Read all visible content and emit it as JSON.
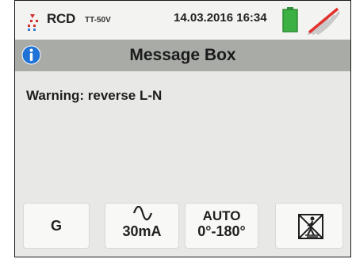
{
  "status_bar": {
    "mode": "RCD",
    "mode_sub": "TT-50V",
    "datetime": "14.03.2016  16:34",
    "icons": [
      "rcd-icon",
      "battery-icon",
      "no-signal-icon"
    ],
    "battery_color": "#3cb043",
    "signal_strike_color": "#e2312f"
  },
  "title_bar": {
    "title": "Message Box",
    "icon": "info-icon",
    "info_color": "#1f73d6"
  },
  "message": "Warning: reverse L-N",
  "softkeys": [
    {
      "label": "G"
    },
    {
      "icon": "ac-wave-icon",
      "label": "30mA"
    },
    {
      "line1": "AUTO",
      "line2": "0°-180°"
    },
    {
      "icon": "no-ground-contact-icon"
    }
  ]
}
